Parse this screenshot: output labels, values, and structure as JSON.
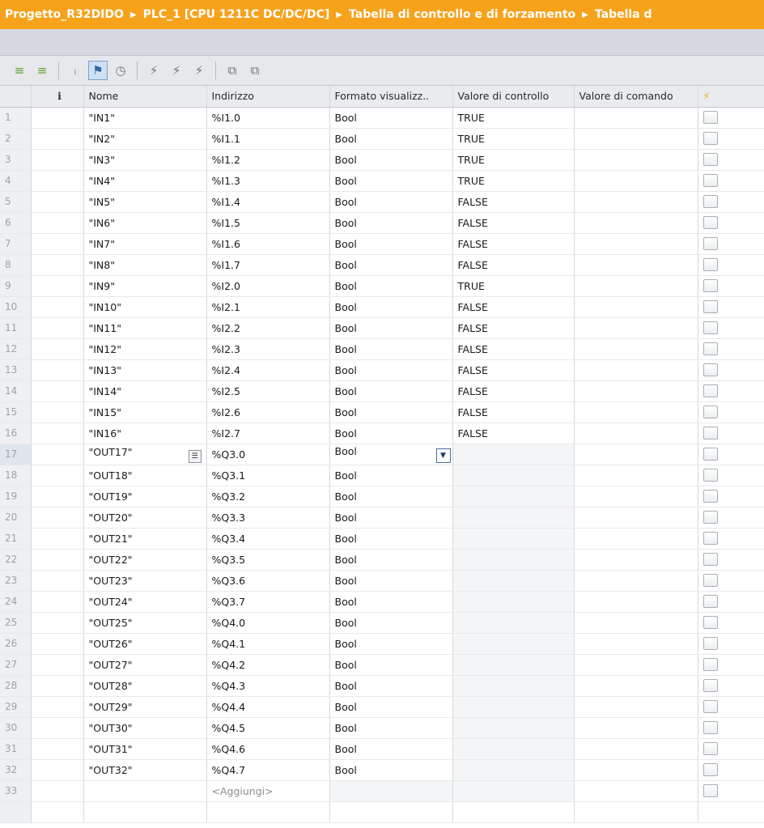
{
  "breadcrumb": {
    "items": [
      "Progetto_R32DIDO",
      "PLC_1 [CPU 1211C DC/DC/DC]",
      "Tabella di controllo e di forzamento",
      "Tabella d"
    ]
  },
  "toolbar": {
    "icons": [
      "insert-row-icon",
      "add-row-icon",
      "show-all-icon",
      "monitor-all-icon",
      "monitor-once-icon",
      "modify-now-icon",
      "modify-trigger-icon",
      "enable-peripheral-icon",
      "monitor-start-icon",
      "monitor-single-icon"
    ]
  },
  "table": {
    "headers": {
      "info": "i",
      "name": "Nome",
      "address": "Indirizzo",
      "format": "Formato visualizz..",
      "monitor": "Valore di controllo",
      "modify": "Valore di comando"
    },
    "rows": [
      {
        "n": "1",
        "name": "\"IN1\"",
        "addr": "%I1.0",
        "fmt": "Bool",
        "val": "TRUE"
      },
      {
        "n": "2",
        "name": "\"IN2\"",
        "addr": "%I1.1",
        "fmt": "Bool",
        "val": "TRUE"
      },
      {
        "n": "3",
        "name": "\"IN3\"",
        "addr": "%I1.2",
        "fmt": "Bool",
        "val": "TRUE"
      },
      {
        "n": "4",
        "name": "\"IN4\"",
        "addr": "%I1.3",
        "fmt": "Bool",
        "val": "TRUE"
      },
      {
        "n": "5",
        "name": "\"IN5\"",
        "addr": "%I1.4",
        "fmt": "Bool",
        "val": "FALSE"
      },
      {
        "n": "6",
        "name": "\"IN6\"",
        "addr": "%I1.5",
        "fmt": "Bool",
        "val": "FALSE"
      },
      {
        "n": "7",
        "name": "\"IN7\"",
        "addr": "%I1.6",
        "fmt": "Bool",
        "val": "FALSE"
      },
      {
        "n": "8",
        "name": "\"IN8\"",
        "addr": "%I1.7",
        "fmt": "Bool",
        "val": "FALSE"
      },
      {
        "n": "9",
        "name": "\"IN9\"",
        "addr": "%I2.0",
        "fmt": "Bool",
        "val": "TRUE"
      },
      {
        "n": "10",
        "name": "\"IN10\"",
        "addr": "%I2.1",
        "fmt": "Bool",
        "val": "FALSE"
      },
      {
        "n": "11",
        "name": "\"IN11\"",
        "addr": "%I2.2",
        "fmt": "Bool",
        "val": "FALSE"
      },
      {
        "n": "12",
        "name": "\"IN12\"",
        "addr": "%I2.3",
        "fmt": "Bool",
        "val": "FALSE"
      },
      {
        "n": "13",
        "name": "\"IN13\"",
        "addr": "%I2.4",
        "fmt": "Bool",
        "val": "FALSE"
      },
      {
        "n": "14",
        "name": "\"IN14\"",
        "addr": "%I2.5",
        "fmt": "Bool",
        "val": "FALSE"
      },
      {
        "n": "15",
        "name": "\"IN15\"",
        "addr": "%I2.6",
        "fmt": "Bool",
        "val": "FALSE"
      },
      {
        "n": "16",
        "name": "\"IN16\"",
        "addr": "%I2.7",
        "fmt": "Bool",
        "val": "FALSE"
      },
      {
        "n": "17",
        "name": "\"OUT17\"",
        "addr": "%Q3.0",
        "fmt": "Bool",
        "val": ""
      },
      {
        "n": "18",
        "name": "\"OUT18\"",
        "addr": "%Q3.1",
        "fmt": "Bool",
        "val": ""
      },
      {
        "n": "19",
        "name": "\"OUT19\"",
        "addr": "%Q3.2",
        "fmt": "Bool",
        "val": ""
      },
      {
        "n": "20",
        "name": "\"OUT20\"",
        "addr": "%Q3.3",
        "fmt": "Bool",
        "val": ""
      },
      {
        "n": "21",
        "name": "\"OUT21\"",
        "addr": "%Q3.4",
        "fmt": "Bool",
        "val": ""
      },
      {
        "n": "22",
        "name": "\"OUT22\"",
        "addr": "%Q3.5",
        "fmt": "Bool",
        "val": ""
      },
      {
        "n": "23",
        "name": "\"OUT23\"",
        "addr": "%Q3.6",
        "fmt": "Bool",
        "val": ""
      },
      {
        "n": "24",
        "name": "\"OUT24\"",
        "addr": "%Q3.7",
        "fmt": "Bool",
        "val": ""
      },
      {
        "n": "25",
        "name": "\"OUT25\"",
        "addr": "%Q4.0",
        "fmt": "Bool",
        "val": ""
      },
      {
        "n": "26",
        "name": "\"OUT26\"",
        "addr": "%Q4.1",
        "fmt": "Bool",
        "val": ""
      },
      {
        "n": "27",
        "name": "\"OUT27\"",
        "addr": "%Q4.2",
        "fmt": "Bool",
        "val": ""
      },
      {
        "n": "28",
        "name": "\"OUT28\"",
        "addr": "%Q4.3",
        "fmt": "Bool",
        "val": ""
      },
      {
        "n": "29",
        "name": "\"OUT29\"",
        "addr": "%Q4.4",
        "fmt": "Bool",
        "val": ""
      },
      {
        "n": "30",
        "name": "\"OUT30\"",
        "addr": "%Q4.5",
        "fmt": "Bool",
        "val": ""
      },
      {
        "n": "31",
        "name": "\"OUT31\"",
        "addr": "%Q4.6",
        "fmt": "Bool",
        "val": ""
      },
      {
        "n": "32",
        "name": "\"OUT32\"",
        "addr": "%Q4.7",
        "fmt": "Bool",
        "val": ""
      }
    ],
    "add_row": {
      "n": "33",
      "placeholder": "<Aggiungi>"
    },
    "selected_row": "17"
  },
  "colors": {
    "title_bar": "#f7a21b",
    "accent": "#f0b400"
  }
}
